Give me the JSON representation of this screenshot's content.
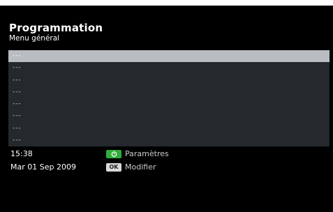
{
  "header": {
    "title": "Programmation",
    "subtitle": "Menu général"
  },
  "list": {
    "items": [
      {
        "label": "---",
        "selected": true
      },
      {
        "label": "---",
        "selected": false
      },
      {
        "label": "---",
        "selected": false
      },
      {
        "label": "---",
        "selected": false
      },
      {
        "label": "---",
        "selected": false
      },
      {
        "label": "---",
        "selected": false
      },
      {
        "label": "---",
        "selected": false
      },
      {
        "label": "---",
        "selected": false
      }
    ]
  },
  "status": {
    "time": "15:38",
    "date": "Mar 01 Sep 2009"
  },
  "legend": {
    "settings_label": "Paramètres",
    "settings_icon": "power-icon",
    "settings_color": "#2fae3a",
    "ok_key": "OK",
    "modify_label": "Modifier"
  }
}
